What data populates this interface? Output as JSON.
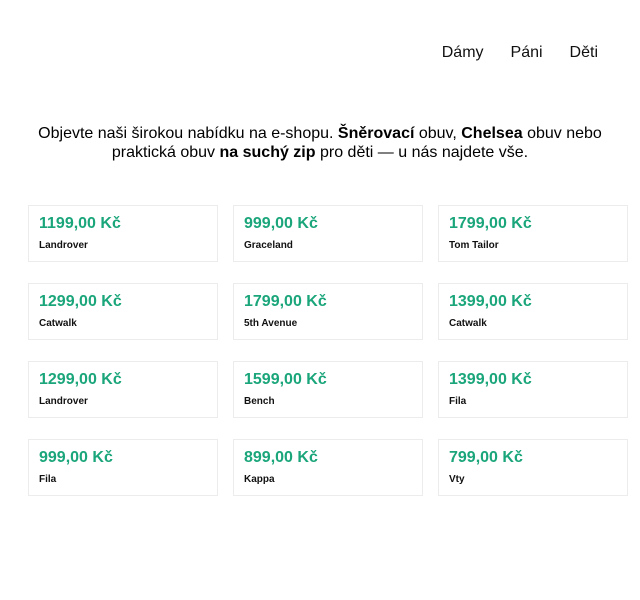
{
  "nav": {
    "items": [
      "Dámy",
      "Páni",
      "Děti"
    ]
  },
  "intro": {
    "t1": "Objevte naši širokou nabídku na e-shopu. ",
    "b1": "Šněrovací",
    "t2": " obuv, ",
    "b2": "Chelsea",
    "t3": " obuv nebo praktická obuv ",
    "b3": "na suchý zip",
    "t4": " pro děti — u nás najdete vše."
  },
  "products": [
    {
      "price": "1199,00 Kč",
      "brand": "Landrover"
    },
    {
      "price": "999,00 Kč",
      "brand": "Graceland"
    },
    {
      "price": "1799,00 Kč",
      "brand": "Tom Tailor"
    },
    {
      "price": "1299,00 Kč",
      "brand": "Catwalk"
    },
    {
      "price": "1799,00 Kč",
      "brand": "5th Avenue"
    },
    {
      "price": "1399,00 Kč",
      "brand": "Catwalk"
    },
    {
      "price": "1299,00 Kč",
      "brand": "Landrover"
    },
    {
      "price": "1599,00 Kč",
      "brand": "Bench"
    },
    {
      "price": "1399,00 Kč",
      "brand": "Fila"
    },
    {
      "price": "999,00 Kč",
      "brand": "Fila"
    },
    {
      "price": "899,00 Kč",
      "brand": "Kappa"
    },
    {
      "price": "799,00 Kč",
      "brand": "Vty"
    }
  ],
  "colors": {
    "price": "#1aa57a",
    "card_border": "#ececec"
  }
}
